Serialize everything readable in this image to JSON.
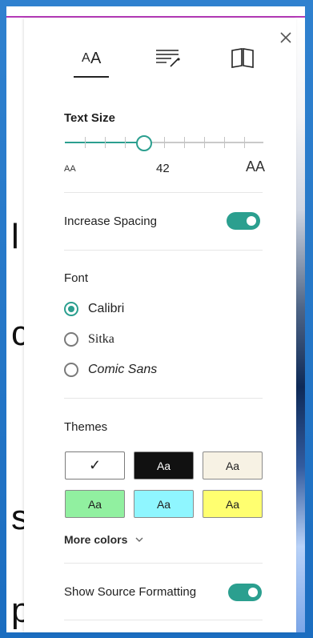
{
  "colors": {
    "accent": "#2b9f8f",
    "frame": "#1f6fc0",
    "top_accent": "#b43ab7"
  },
  "background_text": {
    "letters": [
      "l",
      "c",
      "s",
      "p"
    ]
  },
  "panel": {
    "tabs": [
      {
        "name": "text-options",
        "icon": "text-size-icon"
      },
      {
        "name": "grammar-options",
        "icon": "grammar-tools-icon"
      },
      {
        "name": "reading-preferences",
        "icon": "book-icon"
      }
    ],
    "text_size": {
      "label": "Text Size",
      "value": "42",
      "min_glyph": "AA",
      "max_glyph": "AA",
      "slider_fraction": 0.4
    },
    "increase_spacing": {
      "label": "Increase Spacing",
      "enabled": true
    },
    "font": {
      "label": "Font",
      "options": [
        "Calibri",
        "Sitka",
        "Comic Sans"
      ],
      "selected": "Calibri"
    },
    "themes": {
      "label": "Themes",
      "swatches": [
        {
          "text": "✓",
          "bg": "#ffffff",
          "fg": "#202020",
          "selected": true
        },
        {
          "text": "Aa",
          "bg": "#111111",
          "fg": "#ffffff"
        },
        {
          "text": "Aa",
          "bg": "#f7f2e4",
          "fg": "#202020"
        },
        {
          "text": "Aa",
          "bg": "#91f0a0",
          "fg": "#202020"
        },
        {
          "text": "Aa",
          "bg": "#8ff6ff",
          "fg": "#202020"
        },
        {
          "text": "Aa",
          "bg": "#ffff70",
          "fg": "#202020"
        }
      ],
      "more_label": "More colors"
    },
    "show_source_formatting": {
      "label": "Show Source Formatting",
      "enabled": true
    }
  }
}
